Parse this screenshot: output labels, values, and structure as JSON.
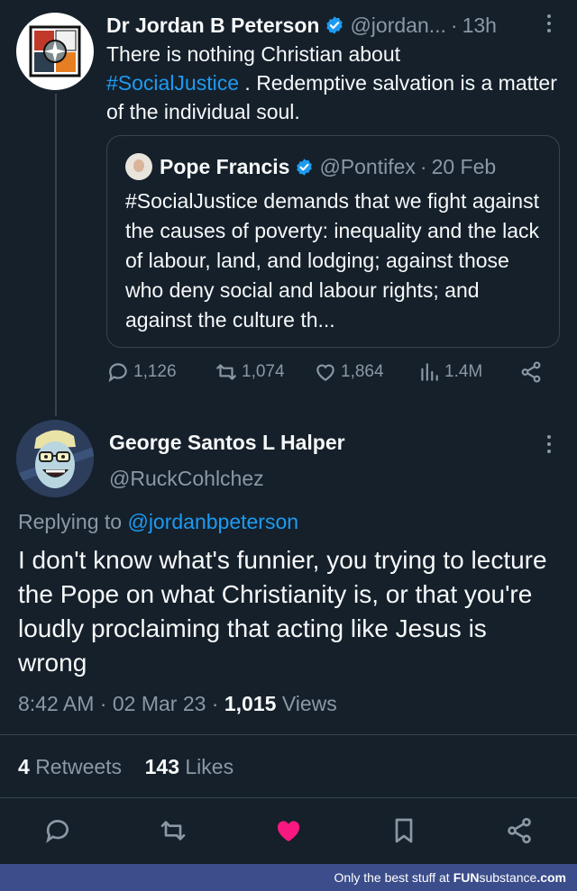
{
  "tweet": {
    "author_name": "Dr Jordan B Peterson",
    "author_handle": "@jordan...",
    "separator": "·",
    "time_ago": "13h",
    "text_line1": "There is nothing Christian about",
    "hashtag": "#SocialJustice",
    "text_rest": " . Redemptive salvation is a matter of the individual soul.",
    "quote": {
      "author_name": "Pope Francis",
      "author_handle": "@Pontifex",
      "separator": "·",
      "date": "20 Feb",
      "text": "#SocialJustice demands that we fight against the causes of poverty: inequality and the lack of labour, land, and lodging; against those who deny social and labour rights; and against the culture th..."
    },
    "actions": {
      "replies": "1,126",
      "retweets": "1,074",
      "likes": "1,864",
      "views": "1.4M"
    }
  },
  "reply": {
    "author_name": "George Santos L Halper",
    "author_handle": "@RuckCohlchez",
    "replying_prefix": "Replying to",
    "replying_to": "@jordanbpeterson",
    "text": "I don't know what's funnier, you trying to lecture the Pope on what Christianity is, or that you're loudly proclaiming that acting like Jesus is wrong",
    "time": "8:42 AM",
    "separator": "·",
    "date": "02 Mar 23",
    "separator2": "·",
    "views_count": "1,015",
    "views_label": "Views",
    "retweets_count": "4",
    "retweets_label": "Retweets",
    "likes_count": "143",
    "likes_label": "Likes"
  },
  "watermark": {
    "text": "Only the best stuff at",
    "brand_a": "FUN",
    "brand_b": "substance",
    "brand_c": ".com"
  },
  "colors": {
    "background": "#15202b",
    "accent": "#1d9bf0",
    "muted": "#8b98a5",
    "like": "#f91880"
  },
  "icons": [
    "verified-badge-icon",
    "more-vertical-icon",
    "reply-icon",
    "retweet-icon",
    "like-icon",
    "views-icon",
    "share-icon"
  ]
}
